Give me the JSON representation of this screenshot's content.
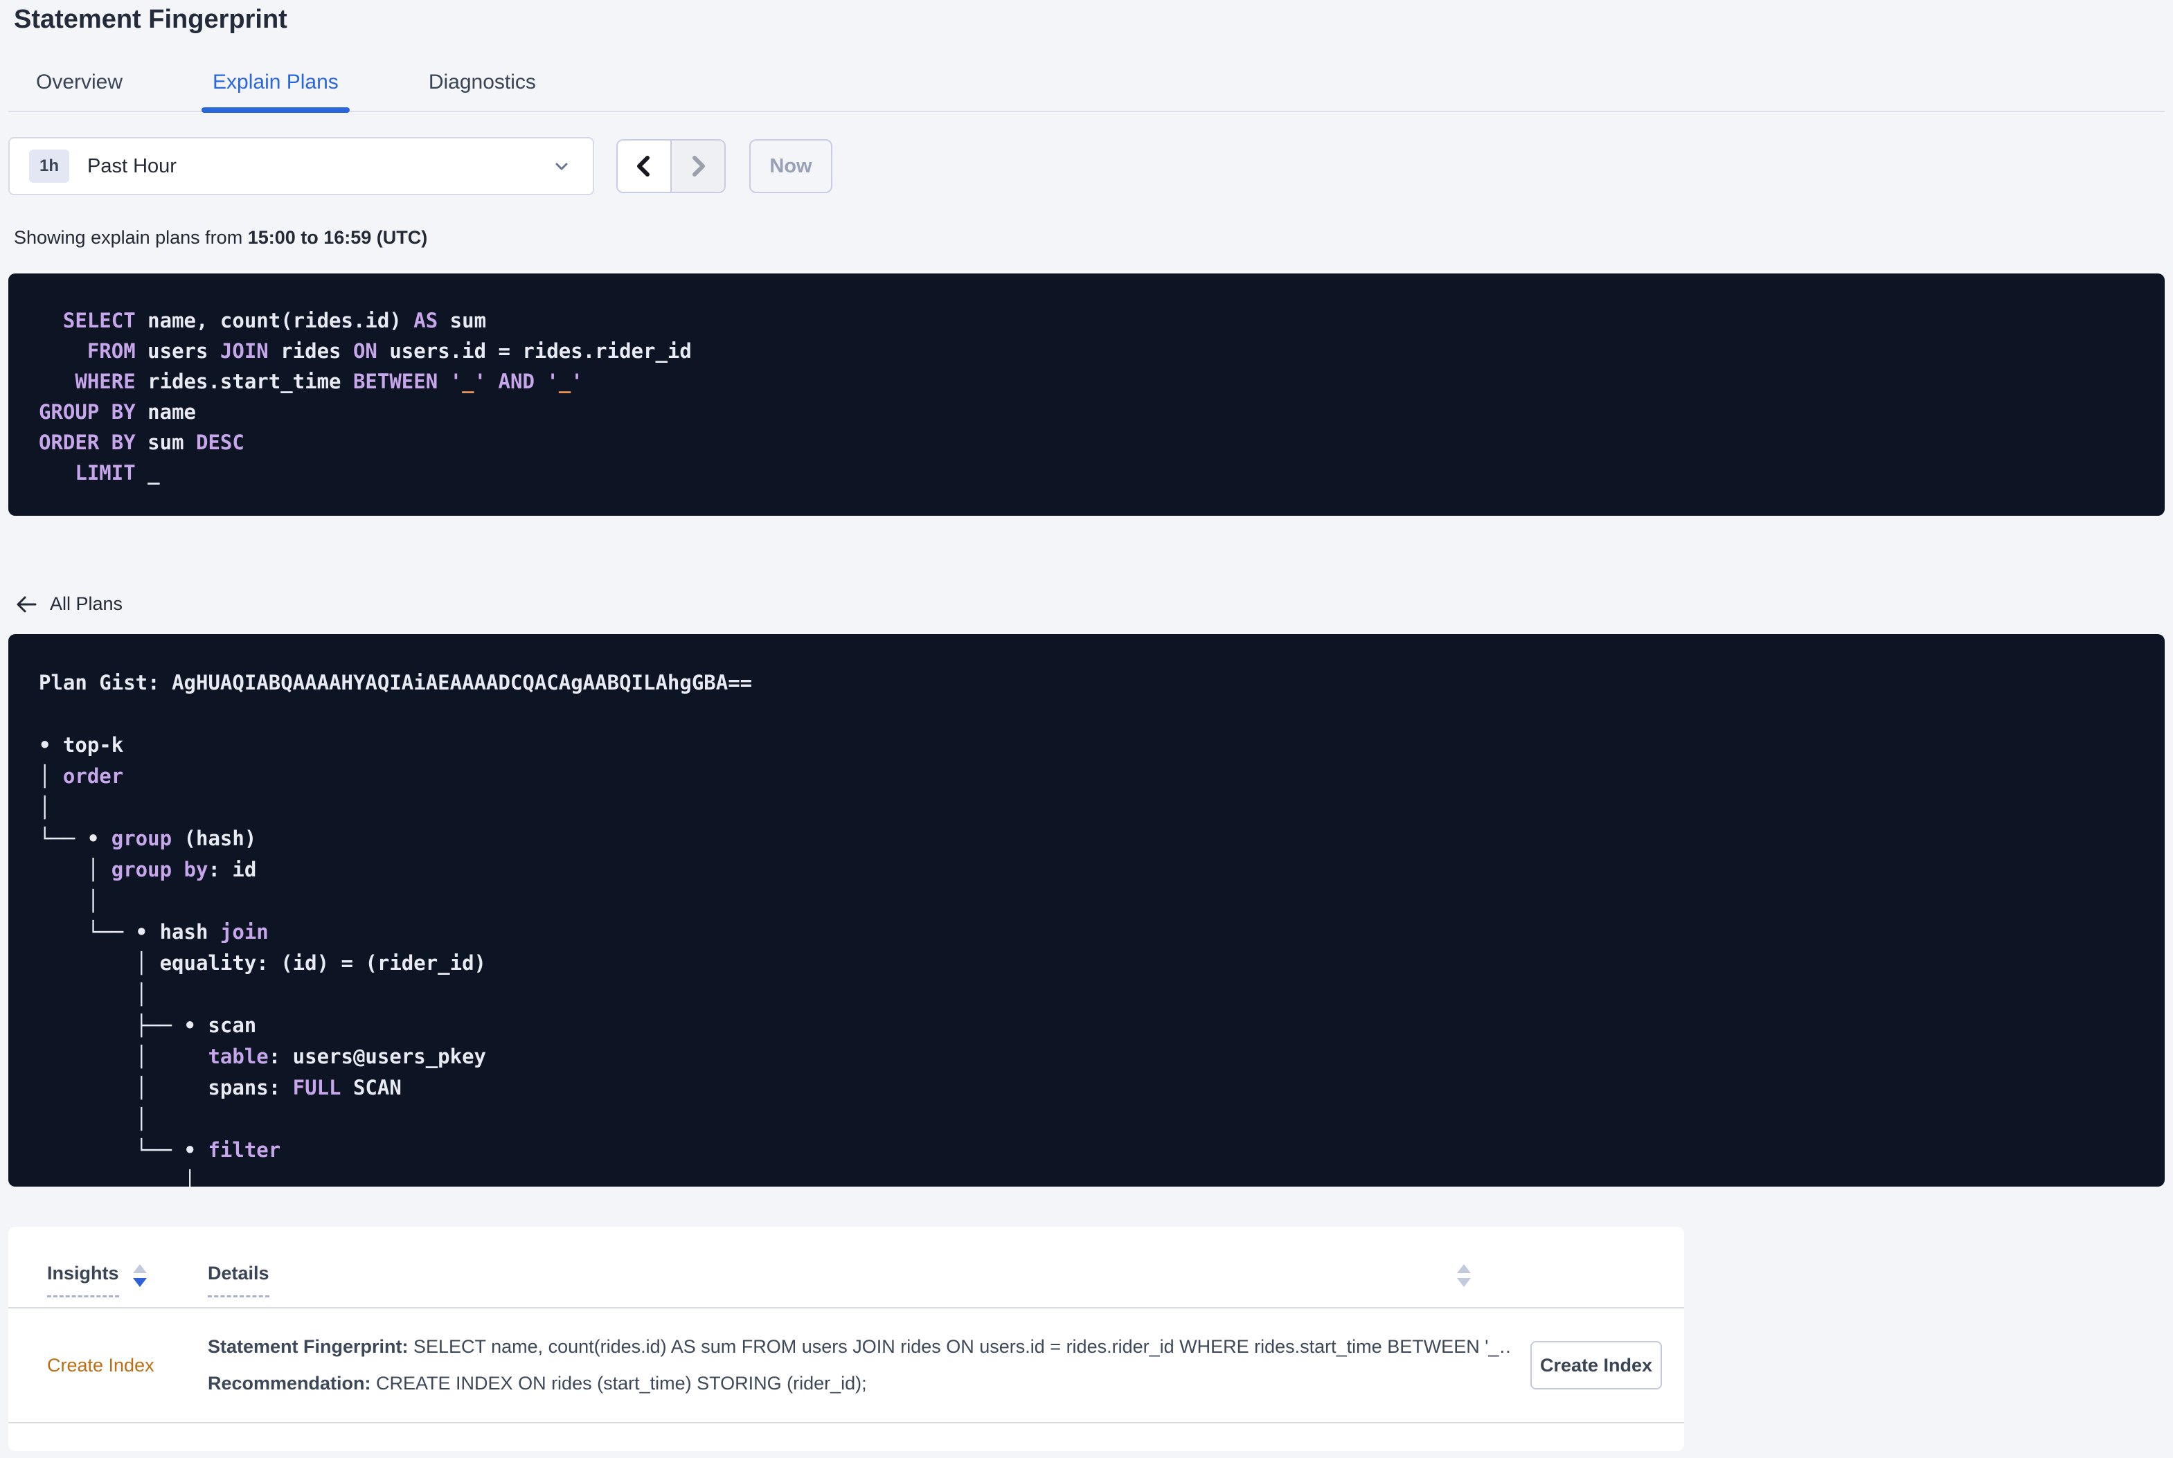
{
  "page": {
    "title": "Statement Fingerprint"
  },
  "tabs": [
    {
      "label": "Overview"
    },
    {
      "label": "Explain Plans"
    },
    {
      "label": "Diagnostics"
    }
  ],
  "time_picker": {
    "badge": "1h",
    "selected": "Past Hour",
    "now": "Now"
  },
  "subtitle": {
    "prefix": "Showing explain plans from ",
    "bold": "15:00 to 16:59 (UTC)"
  },
  "colors": {
    "accent_blue": "#2a66dc",
    "code_background": "#0d1524",
    "code_keyword_purple": "#c7a6ec",
    "code_text_white": "#e8ebf3",
    "code_literal_orange": "#ec9552",
    "insight_link_orange": "#bd6e15",
    "sort_active_blue": "#2f62d6"
  },
  "sql": {
    "lines": [
      [
        {
          "c": "k",
          "t": "  SELECT"
        },
        {
          "c": "w",
          "t": " name, count(rides.id) "
        },
        {
          "c": "k",
          "t": "AS"
        },
        {
          "c": "w",
          "t": " sum"
        }
      ],
      [
        {
          "c": "k",
          "t": "    FROM"
        },
        {
          "c": "w",
          "t": " users "
        },
        {
          "c": "k",
          "t": "JOIN"
        },
        {
          "c": "w",
          "t": " rides "
        },
        {
          "c": "k",
          "t": "ON"
        },
        {
          "c": "w",
          "t": " users.id = rides.rider_id"
        }
      ],
      [
        {
          "c": "k",
          "t": "   WHERE"
        },
        {
          "c": "w",
          "t": " rides.start_time "
        },
        {
          "c": "k",
          "t": "BETWEEN"
        },
        {
          "c": "w",
          "t": " "
        },
        {
          "c": "k",
          "t": "'"
        },
        {
          "c": "o",
          "t": "_"
        },
        {
          "c": "k",
          "t": "'"
        },
        {
          "c": "w",
          "t": " "
        },
        {
          "c": "k",
          "t": "AND"
        },
        {
          "c": "w",
          "t": " "
        },
        {
          "c": "k",
          "t": "'"
        },
        {
          "c": "o",
          "t": "_"
        },
        {
          "c": "k",
          "t": "'"
        }
      ],
      [
        {
          "c": "k",
          "t": "GROUP BY"
        },
        {
          "c": "w",
          "t": " name"
        }
      ],
      [
        {
          "c": "k",
          "t": "ORDER BY"
        },
        {
          "c": "w",
          "t": " sum "
        },
        {
          "c": "k",
          "t": "DESC"
        }
      ],
      [
        {
          "c": "k",
          "t": "   LIMIT"
        },
        {
          "c": "w",
          "t": " _"
        }
      ]
    ]
  },
  "plan": {
    "back_label": "All Plans",
    "gist_prefix": "Plan Gist: ",
    "gist": "AgHUAQIABQAAAAHYAQIAiAEAAAADCQACAgAABQILAhgGBA==",
    "tree": [
      [
        {
          "c": "w",
          "t": "• top-k"
        }
      ],
      [
        {
          "c": "w",
          "t": "│ "
        },
        {
          "c": "k",
          "t": "order"
        }
      ],
      [
        {
          "c": "w",
          "t": "│"
        }
      ],
      [
        {
          "c": "w",
          "t": "└── • "
        },
        {
          "c": "k",
          "t": "group"
        },
        {
          "c": "w",
          "t": " (hash)"
        }
      ],
      [
        {
          "c": "w",
          "t": "    │ "
        },
        {
          "c": "k",
          "t": "group by"
        },
        {
          "c": "w",
          "t": ": id"
        }
      ],
      [
        {
          "c": "w",
          "t": "    │"
        }
      ],
      [
        {
          "c": "w",
          "t": "    └── • hash "
        },
        {
          "c": "k",
          "t": "join"
        }
      ],
      [
        {
          "c": "w",
          "t": "        │ equality: (id) = (rider_id)"
        }
      ],
      [
        {
          "c": "w",
          "t": "        │"
        }
      ],
      [
        {
          "c": "w",
          "t": "        ├── • scan"
        }
      ],
      [
        {
          "c": "w",
          "t": "        │     "
        },
        {
          "c": "k",
          "t": "table"
        },
        {
          "c": "w",
          "t": ": users@users_pkey"
        }
      ],
      [
        {
          "c": "w",
          "t": "        │     spans: "
        },
        {
          "c": "k",
          "t": "FULL"
        },
        {
          "c": "w",
          "t": " SCAN"
        }
      ],
      [
        {
          "c": "w",
          "t": "        │"
        }
      ],
      [
        {
          "c": "w",
          "t": "        └── • "
        },
        {
          "c": "k",
          "t": "filter"
        }
      ],
      [
        {
          "c": "w",
          "t": "            │"
        }
      ]
    ]
  },
  "insights": {
    "columns": [
      {
        "label": "Insights"
      },
      {
        "label": "Details"
      }
    ],
    "rows": [
      {
        "insight": "Create Index",
        "details": [
          {
            "label": "Statement Fingerprint:",
            "text": " SELECT name, count(rides.id) AS sum FROM users JOIN rides ON users.id = rides.rider_id WHERE rides.start_time BETWEEN '_…"
          },
          {
            "label": "Recommendation:",
            "text": " CREATE INDEX ON rides (start_time) STORING (rider_id);"
          }
        ],
        "action": "Create Index"
      }
    ]
  }
}
